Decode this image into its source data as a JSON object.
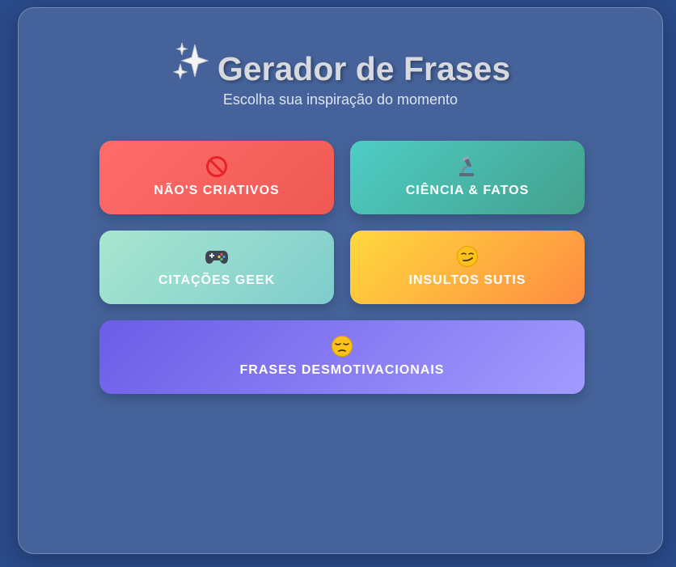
{
  "header": {
    "title": "Gerador de Frases",
    "subtitle": "Escolha sua inspiração do momento",
    "title_icon": "sparkles-icon"
  },
  "categories": [
    {
      "label": "NÃO'S CRIATIVOS",
      "icon": "prohibited-icon"
    },
    {
      "label": "CIÊNCIA & FATOS",
      "icon": "microscope-icon"
    },
    {
      "label": "CITAÇÕES GEEK",
      "icon": "game-controller-icon"
    },
    {
      "label": "INSULTOS SUTIS",
      "icon": "smirk-face-icon"
    },
    {
      "label": "FRASES DESMOTIVACIONAIS",
      "icon": "pensive-face-icon"
    }
  ],
  "colors": {
    "page_background": "#2a4a8a",
    "card_background": "#45639a",
    "title_text": "#d7d9df",
    "nao_gradient": [
      "#ff6b6b",
      "#ee5a52"
    ],
    "ciencia_gradient": [
      "#4ecdc4",
      "#44a08d"
    ],
    "geek_gradient": [
      "#a8e6cf",
      "#7fcdcd"
    ],
    "insultos_gradient": [
      "#ffd93d",
      "#ff8c42"
    ],
    "desmotivacionais_gradient": [
      "#6c5ce7",
      "#a29bfe"
    ]
  }
}
